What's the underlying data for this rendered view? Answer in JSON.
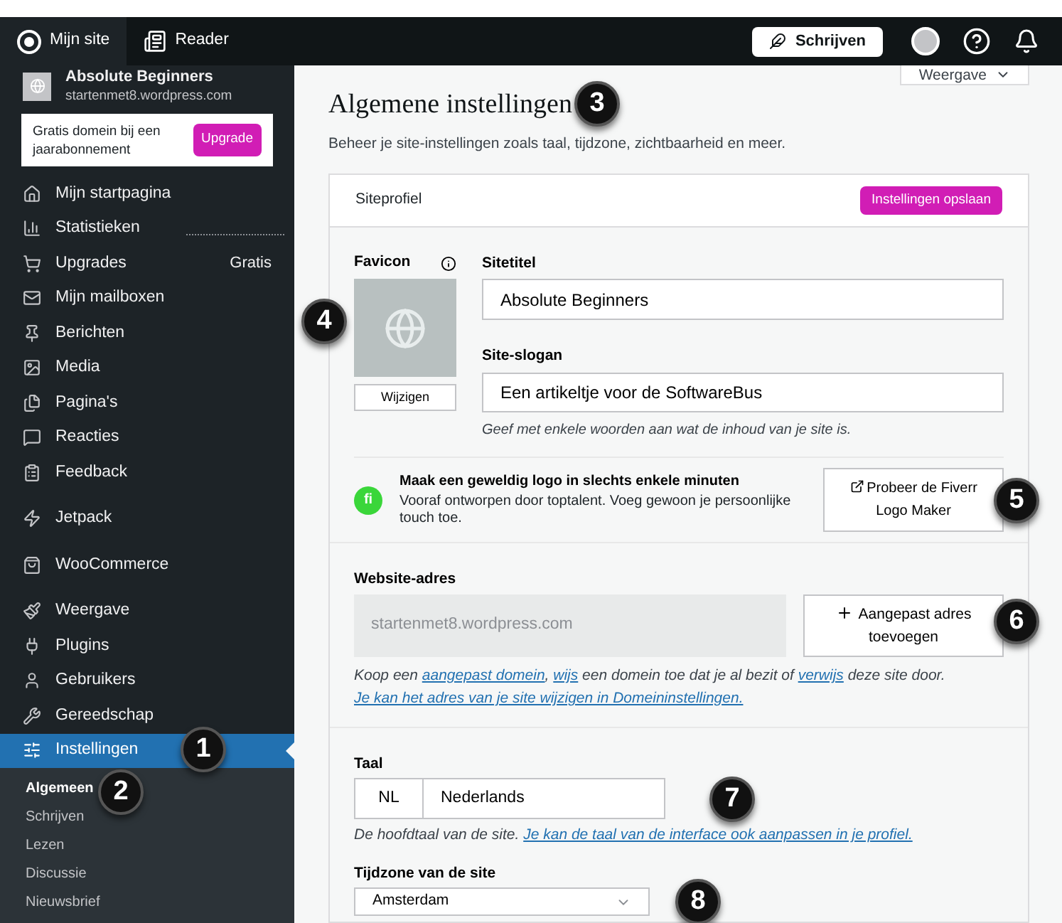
{
  "topbar": {
    "left": [
      {
        "kind": "wp",
        "label": "Mijn site",
        "selected": true
      },
      {
        "kind": "reader",
        "label": "Reader",
        "selected": false
      }
    ],
    "write_button": "Schrijven"
  },
  "sidebar": {
    "site": {
      "name": "Absolute Beginners",
      "url": "startenmet8.wordpress.com"
    },
    "promo": {
      "text": "Gratis domein bij een jaarabonnement",
      "button": "Upgrade"
    },
    "groups": [
      [
        {
          "label": "Mijn startpagina",
          "selected": false
        },
        {
          "label": "Statistieken",
          "selected": false
        },
        {
          "label": "Upgrades",
          "badge": "Gratis",
          "selected": false
        },
        {
          "label": "Mijn mailboxen",
          "selected": false
        },
        {
          "label": "Berichten",
          "selected": false
        },
        {
          "label": "Media",
          "selected": false
        },
        {
          "label": "Pagina's",
          "selected": false
        },
        {
          "label": "Reacties",
          "selected": false
        },
        {
          "label": "Feedback",
          "selected": false
        }
      ],
      [
        {
          "label": "Jetpack",
          "selected": false
        }
      ],
      [
        {
          "label": "WooCommerce",
          "selected": false
        }
      ],
      [
        {
          "label": "Weergave",
          "selected": false
        },
        {
          "label": "Plugins",
          "selected": false
        },
        {
          "label": "Gebruikers",
          "selected": false
        },
        {
          "label": "Gereedschap",
          "selected": false
        },
        {
          "label": "Instellingen",
          "selected": true
        }
      ]
    ],
    "subitems": [
      {
        "label": "Algemeen",
        "selected": true
      },
      {
        "label": "Schrijven",
        "selected": false
      },
      {
        "label": "Lezen",
        "selected": false
      },
      {
        "label": "Discussie",
        "selected": false
      },
      {
        "label": "Nieuwsbrief",
        "selected": false
      }
    ]
  },
  "main": {
    "view_button": "Weergave",
    "title": "Algemene instellingen",
    "subtitle": "Beheer je site-instellingen zoals taal, tijdzone, zichtbaarheid en meer.",
    "card_title": "Siteprofiel",
    "save_button": "Instellingen opslaan",
    "favicon": {
      "label": "Favicon",
      "button": "Wijzigen"
    },
    "site_title": {
      "label": "Sitetitel",
      "value": "Absolute Beginners"
    },
    "slogan": {
      "label": "Site-slogan",
      "value": "Een artikeltje voor de SoftwareBus",
      "help": "Geef met enkele woorden aan wat de inhoud van je site is."
    },
    "fiverr": {
      "logo": "fi",
      "heading": "Maak een geweldig logo in slechts enkele minuten",
      "text": "Vooraf ontworpen door toptalent. Voeg gewoon je persoonlijke touch toe.",
      "button": "Probeer de Fiverr Logo Maker"
    },
    "address": {
      "label": "Website-adres",
      "value": "startenmet8.wordpress.com",
      "button": "Aangepast adres toevoegen",
      "help": [
        {
          "text": "Koop een ",
          "link": false
        },
        {
          "text": "aangepast domein",
          "link": true
        },
        {
          "text": ", ",
          "link": false
        },
        {
          "text": "wijs",
          "link": true
        },
        {
          "text": " een domein toe dat je al bezit of ",
          "link": false
        },
        {
          "text": "verwijs",
          "link": true
        },
        {
          "text": " deze site door. ",
          "link": false
        },
        {
          "text": "Je kan het adres van je site wijzigen in Domeininstellingen.",
          "link": true
        }
      ]
    },
    "language": {
      "label": "Taal",
      "code": "NL",
      "value": "Nederlands",
      "help": [
        {
          "text": "De hoofdtaal van de site. ",
          "link": false
        },
        {
          "text": "Je kan de taal van de interface ook aanpassen in je profiel.",
          "link": true
        }
      ]
    },
    "timezone": {
      "label": "Tijdzone van de site",
      "value": "Amsterdam"
    }
  },
  "callouts": [
    "1",
    "2",
    "3",
    "4",
    "5",
    "6",
    "7",
    "8"
  ]
}
